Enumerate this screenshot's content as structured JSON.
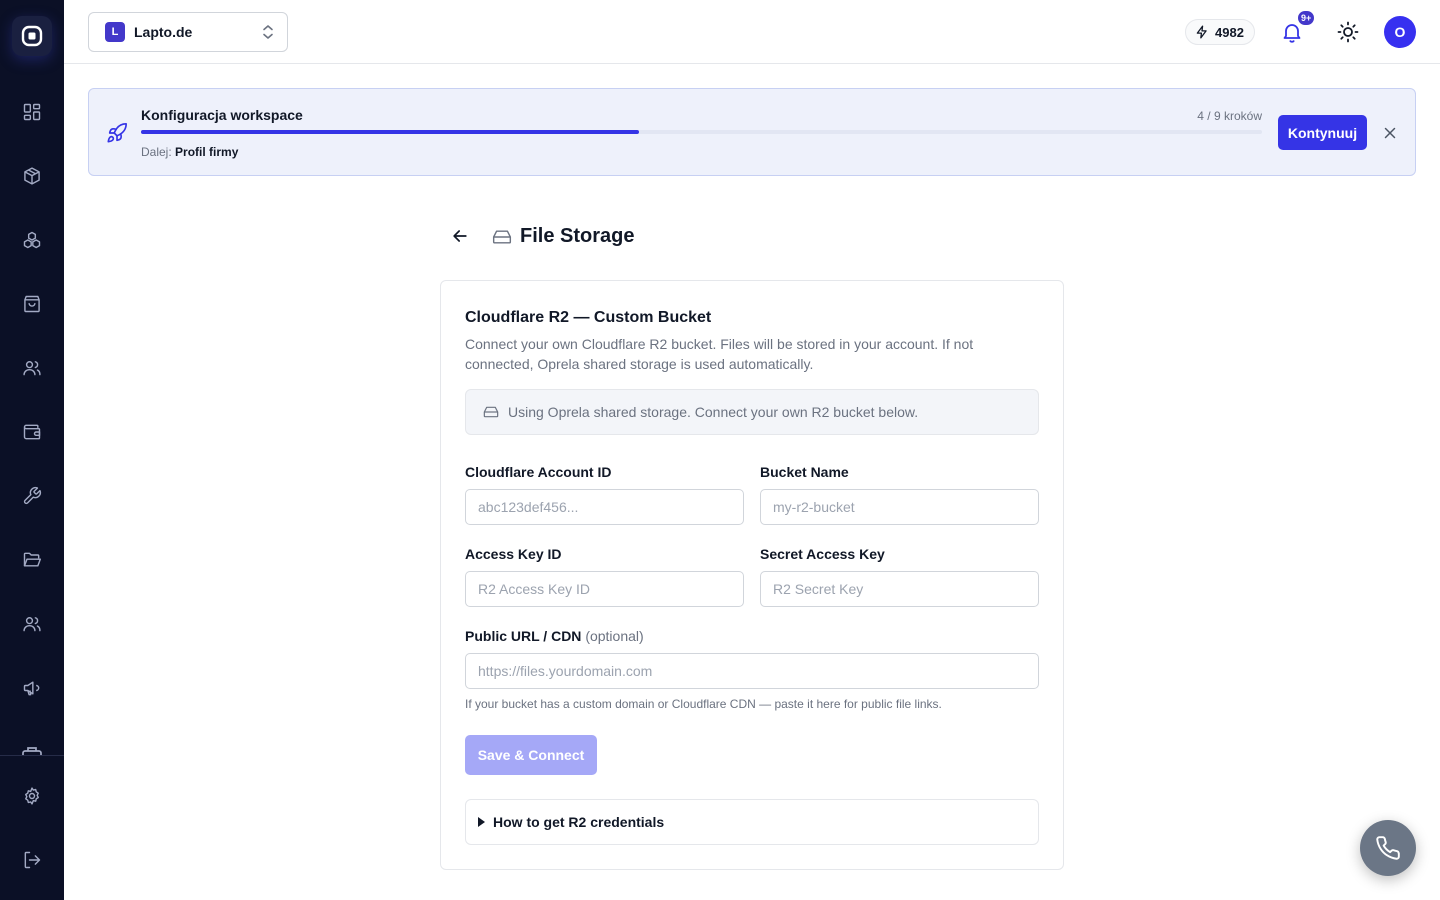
{
  "sidebar": {
    "logo": "app-logo",
    "items": [
      {
        "icon": "dashboard-grid-icon"
      },
      {
        "icon": "box-icon"
      },
      {
        "icon": "integrations-icon"
      },
      {
        "icon": "shopping-bag-icon"
      },
      {
        "icon": "users-icon"
      },
      {
        "icon": "wallet-icon"
      },
      {
        "icon": "wrench-icon"
      },
      {
        "icon": "folder-open-icon"
      },
      {
        "icon": "team-icon"
      },
      {
        "icon": "megaphone-icon"
      }
    ],
    "bottom": [
      {
        "icon": "settings-gear-icon"
      },
      {
        "icon": "logout-icon"
      }
    ]
  },
  "topbar": {
    "workspace_initial": "L",
    "workspace_name": "Lapto.de",
    "credits": "4982",
    "notifications_badge": "9+",
    "avatar_initial": "O"
  },
  "onboarding": {
    "title": "Konfiguracja workspace",
    "steps_text": "4 / 9 kroków",
    "progress": 0.444,
    "next_label": "Dalej:",
    "next_value": "Profil firmy",
    "continue_label": "Kontynuuj"
  },
  "page": {
    "title": "File Storage"
  },
  "card": {
    "title": "Cloudflare R2 — Custom Bucket",
    "description": "Connect your own Cloudflare R2 bucket. Files will be stored in your account. If not connected, Oprela shared storage is used automatically.",
    "notice": "Using Oprela shared storage. Connect your own R2 bucket below.",
    "fields": {
      "account_id": {
        "label": "Cloudflare Account ID",
        "placeholder": "abc123def456..."
      },
      "bucket_name": {
        "label": "Bucket Name",
        "placeholder": "my-r2-bucket"
      },
      "access_key": {
        "label": "Access Key ID",
        "placeholder": "R2 Access Key ID"
      },
      "secret_key": {
        "label": "Secret Access Key",
        "placeholder": "R2 Secret Key"
      },
      "public_url": {
        "label": "Public URL / CDN",
        "optional": "(optional)",
        "placeholder": "https://files.yourdomain.com"
      }
    },
    "helper": "If your bucket has a custom domain or Cloudflare CDN — paste it here for public file links.",
    "save_label": "Save & Connect",
    "howto_label": "How to get R2 credentials"
  },
  "colors": {
    "sidebar_bg": "#0b1026",
    "primary": "#3534e6",
    "primary_disabled": "#a5a8f7",
    "banner_bg": "#eef1fb"
  }
}
